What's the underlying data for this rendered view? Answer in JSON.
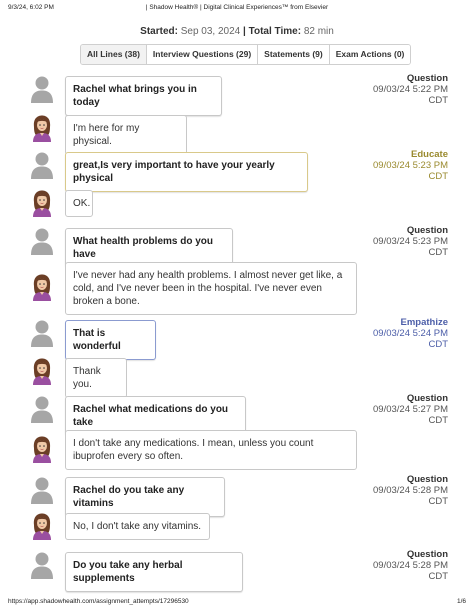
{
  "print_header": {
    "date": "9/3/24, 6:02 PM",
    "title": "| Shadow Health® | Digital Clinical Experiences™ from Elsevier"
  },
  "summary": {
    "started_label": "Started:",
    "started_value": "Sep 03, 2024",
    "separator": "|",
    "total_label": "Total Time:",
    "total_value": "82 min"
  },
  "tabs": [
    {
      "label": "All Lines (38)"
    },
    {
      "label": "Interview Questions (29)"
    },
    {
      "label": "Statements (9)"
    },
    {
      "label": "Exam Actions (0)"
    }
  ],
  "messages": [
    {
      "speaker": "student",
      "text": "Rachel what brings you in today",
      "type": "Question",
      "date": "09/03/24 5:22 PM",
      "tz": "CDT"
    },
    {
      "speaker": "patient",
      "text": "I'm here for my physical."
    },
    {
      "speaker": "student",
      "text": "great,Is very important to have your yearly physical",
      "type": "Educate",
      "date": "09/03/24 5:23 PM",
      "tz": "CDT"
    },
    {
      "speaker": "patient",
      "text": "OK."
    },
    {
      "speaker": "student",
      "text": "What health problems do you have",
      "type": "Question",
      "date": "09/03/24 5:23 PM",
      "tz": "CDT"
    },
    {
      "speaker": "patient",
      "text": "I've never had any health problems. I almost never get like, a cold, and I've never been in the hospital. I've never even broken a bone."
    },
    {
      "speaker": "student",
      "text": "That is wonderful",
      "type": "Empathize",
      "date": "09/03/24 5:24 PM",
      "tz": "CDT"
    },
    {
      "speaker": "patient",
      "text": "Thank you."
    },
    {
      "speaker": "student",
      "text": "Rachel what medications do you take",
      "type": "Question",
      "date": "09/03/24 5:27 PM",
      "tz": "CDT"
    },
    {
      "speaker": "patient",
      "text": "I don't take any medications. I mean, unless you count ibuprofen every so often."
    },
    {
      "speaker": "student",
      "text": "Rachel do you take any vitamins",
      "type": "Question",
      "date": "09/03/24 5:28 PM",
      "tz": "CDT"
    },
    {
      "speaker": "patient",
      "text": "No, I don't take any vitamins."
    },
    {
      "speaker": "student",
      "text": "Do you take any herbal supplements",
      "type": "Question",
      "date": "09/03/24 5:28 PM",
      "tz": "CDT"
    }
  ],
  "print_footer": {
    "url": "https://app.shadowhealth.com/assignment_attempts/17296530",
    "page": "1/6"
  }
}
